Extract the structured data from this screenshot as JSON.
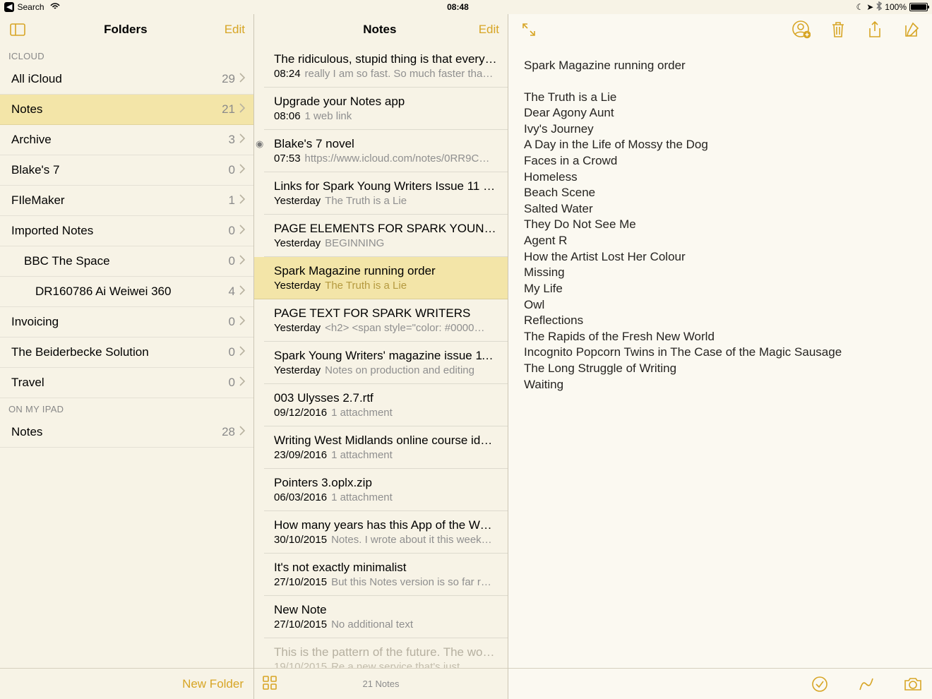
{
  "status": {
    "back_label": "Search",
    "time": "08:48",
    "battery_text": "100%"
  },
  "folders": {
    "title": "Folders",
    "edit": "Edit",
    "new_folder": "New Folder",
    "sections": [
      {
        "label": "ICLOUD",
        "items": [
          {
            "name": "All iCloud",
            "count": "29",
            "indent": 0
          },
          {
            "name": "Notes",
            "count": "21",
            "indent": 0,
            "selected": true
          },
          {
            "name": "Archive",
            "count": "3",
            "indent": 0
          },
          {
            "name": "Blake's 7",
            "count": "0",
            "indent": 0
          },
          {
            "name": "FIleMaker",
            "count": "1",
            "indent": 0
          },
          {
            "name": "Imported Notes",
            "count": "0",
            "indent": 0
          },
          {
            "name": "BBC The Space",
            "count": "0",
            "indent": 1
          },
          {
            "name": "DR160786 Ai Weiwei 360",
            "count": "4",
            "indent": 2
          },
          {
            "name": "Invoicing",
            "count": "0",
            "indent": 0
          },
          {
            "name": "The Beiderbecke Solution",
            "count": "0",
            "indent": 0
          },
          {
            "name": "Travel",
            "count": "0",
            "indent": 0
          }
        ]
      },
      {
        "label": "ON MY IPAD",
        "items": [
          {
            "name": "Notes",
            "count": "28",
            "indent": 0
          }
        ]
      }
    ]
  },
  "notes": {
    "title": "Notes",
    "edit": "Edit",
    "footer_count": "21 Notes",
    "items": [
      {
        "title": "The ridiculous, stupid thing is that every…",
        "time": "08:24",
        "preview": "really I am so fast. So much faster tha…"
      },
      {
        "title": "Upgrade your Notes app",
        "time": "08:06",
        "preview": "1 web link"
      },
      {
        "title": "Blake's 7 novel",
        "time": "07:53",
        "preview": "https://www.icloud.com/notes/0RR9C…",
        "shared": true
      },
      {
        "title": "Links for Spark Young Writers Issue 11 p…",
        "time": "Yesterday",
        "preview": "The Truth is a Lie"
      },
      {
        "title": "PAGE ELEMENTS FOR SPARK YOUNG…",
        "time": "Yesterday",
        "preview": "BEGINNING"
      },
      {
        "title": "Spark Magazine running order",
        "time": "Yesterday",
        "preview": "The Truth is a Lie",
        "selected": true
      },
      {
        "title": "PAGE TEXT FOR SPARK WRITERS",
        "time": "Yesterday",
        "preview": "<h2> <span style=\"color: #0000…"
      },
      {
        "title": "Spark Young Writers' magazine issue 11…",
        "time": "Yesterday",
        "preview": "Notes on production and editing"
      },
      {
        "title": "003 Ulysses 2.7.rtf",
        "time": "09/12/2016",
        "preview": "1 attachment"
      },
      {
        "title": "Writing West Midlands online course ide…",
        "time": "23/09/2016",
        "preview": "1 attachment"
      },
      {
        "title": "Pointers 3.oplx.zip",
        "time": "06/03/2016",
        "preview": "1 attachment"
      },
      {
        "title": "How many years has this App of the We…",
        "time": "30/10/2015",
        "preview": "Notes. I wrote about it this week…"
      },
      {
        "title": "It's not exactly minimalist",
        "time": "27/10/2015",
        "preview": "But this Notes version is so far r…"
      },
      {
        "title": "New Note",
        "time": "27/10/2015",
        "preview": "No additional text"
      },
      {
        "title": "This is the pattern of the future. The wo…",
        "time": "19/10/2015",
        "preview": "Re a new service that's just…",
        "dim": true
      }
    ]
  },
  "editor": {
    "title": "Spark Magazine running order",
    "lines": [
      "The Truth is a Lie",
      "Dear Agony Aunt",
      "Ivy's Journey",
      "A Day in the Life of Mossy the Dog",
      "Faces in a Crowd",
      "Homeless",
      "Beach Scene",
      "Salted Water",
      "They Do Not See Me",
      "Agent R",
      "How the Artist Lost Her Colour",
      "Missing",
      "My Life",
      "Owl",
      "Reflections",
      "The Rapids of the Fresh New World",
      "Incognito Popcorn Twins in The Case of the Magic Sausage",
      "The Long Struggle of Writing",
      "Waiting"
    ]
  }
}
